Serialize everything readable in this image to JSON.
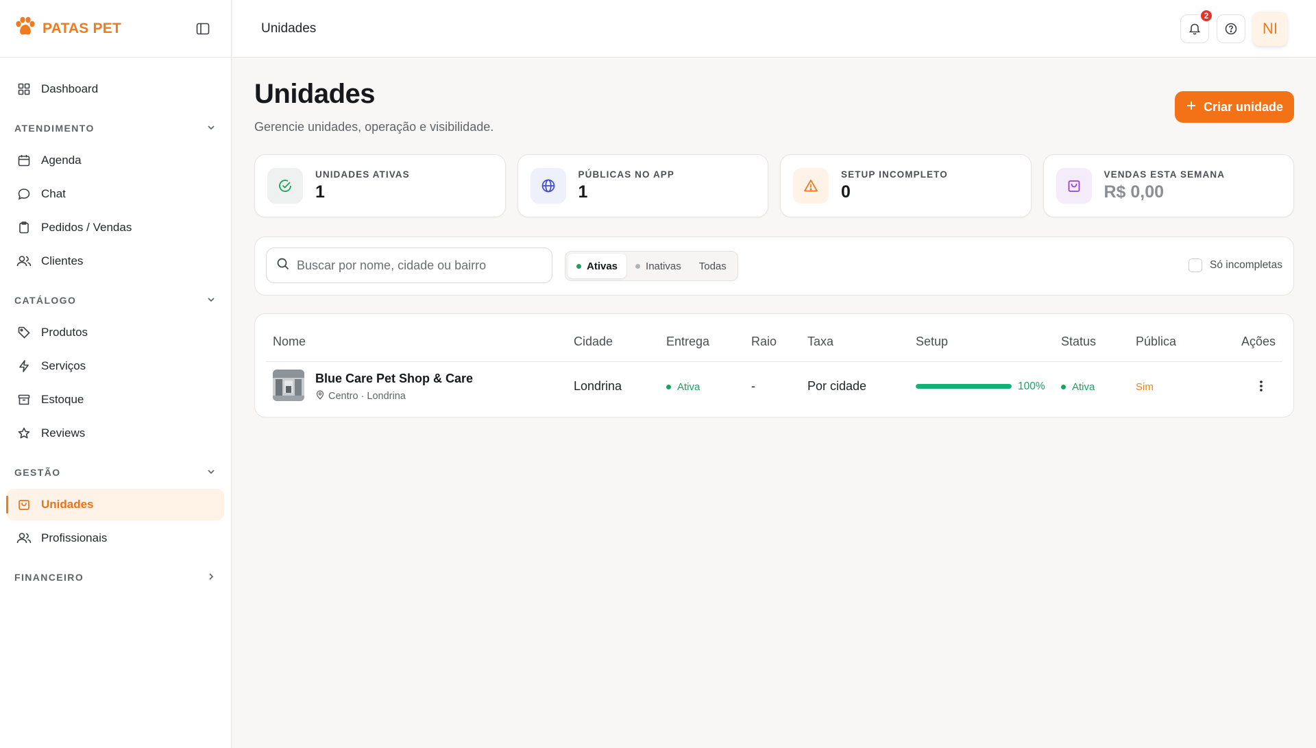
{
  "brand": {
    "name": "PATAS PET",
    "color": "#f07a1e"
  },
  "sidebar": {
    "dashboard": "Dashboard",
    "sections": [
      {
        "label": "ATENDIMENTO",
        "items": [
          "Agenda",
          "Chat",
          "Pedidos / Vendas",
          "Clientes"
        ]
      },
      {
        "label": "CATÁLOGO",
        "items": [
          "Produtos",
          "Serviços",
          "Estoque",
          "Reviews"
        ]
      },
      {
        "label": "GESTÃO",
        "items": [
          "Unidades",
          "Profissionais"
        ]
      },
      {
        "label": "FINANCEIRO",
        "items": []
      }
    ],
    "active_item": "Unidades"
  },
  "topbar": {
    "breadcrumb": "Unidades",
    "notification_count": "2",
    "avatar_initials": "NI"
  },
  "page": {
    "title": "Unidades",
    "subtitle": "Gerencie unidades, operação e visibilidade.",
    "create_button": "Criar unidade"
  },
  "stats": [
    {
      "label": "UNIDADES ATIVAS",
      "value": "1",
      "icon": "check-circle-icon",
      "color": "#16a35f"
    },
    {
      "label": "PÚBLICAS NO APP",
      "value": "1",
      "icon": "globe-icon",
      "color": "#3b4bd8"
    },
    {
      "label": "SETUP INCOMPLETO",
      "value": "0",
      "icon": "warning-icon",
      "color": "#f07a1e"
    },
    {
      "label": "VENDAS ESTA SEMANA",
      "value": "R$ 0,00",
      "icon": "shopping-bag-icon",
      "color": "#9b3fd1"
    }
  ],
  "filters": {
    "search_placeholder": "Buscar por nome, cidade ou bairro",
    "segments": [
      "Ativas",
      "Inativas",
      "Todas"
    ],
    "active_segment": "Ativas",
    "only_incomplete": "Só incompletas"
  },
  "table": {
    "columns": [
      "Nome",
      "Cidade",
      "Entrega",
      "Raio",
      "Taxa",
      "Setup",
      "Status",
      "Pública",
      "Ações"
    ],
    "rows": [
      {
        "name": "Blue Care Pet Shop & Care",
        "location": "Centro · Londrina",
        "city": "Londrina",
        "delivery": "Ativa",
        "radius": "-",
        "fee": "Por cidade",
        "setup_percent": 100,
        "setup_label": "100%",
        "status": "Ativa",
        "public": "Sim"
      }
    ]
  },
  "colors": {
    "accent": "#f47216",
    "success": "#16a35f",
    "public_yes": "#e8861a"
  }
}
